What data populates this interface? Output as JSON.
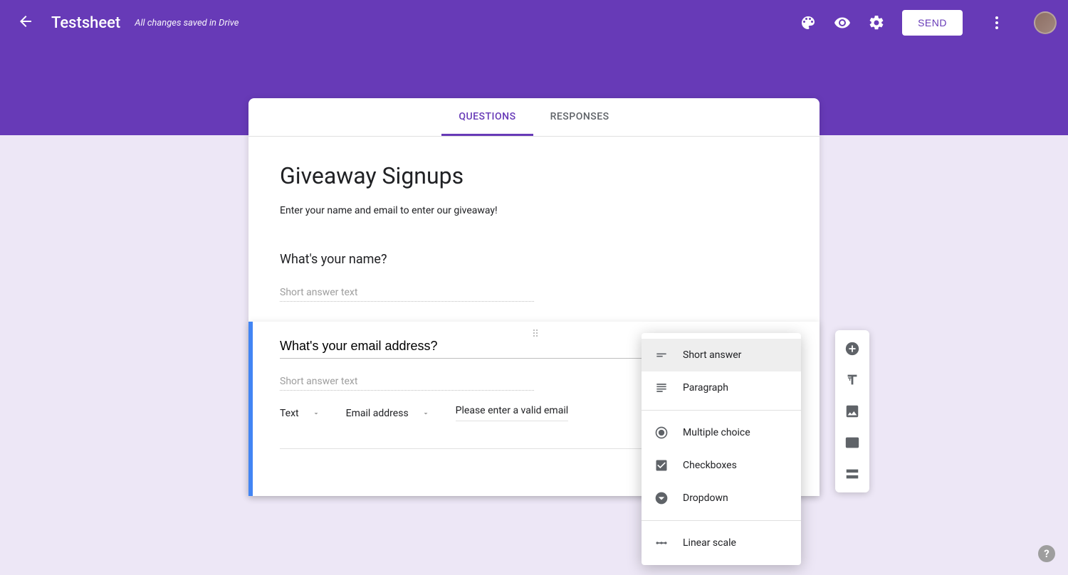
{
  "header": {
    "doc_title": "Testsheet",
    "save_status": "All changes saved in Drive",
    "send_label": "SEND"
  },
  "tabs": {
    "questions": "QUESTIONS",
    "responses": "RESPONSES"
  },
  "form": {
    "title": "Giveaway Signups",
    "description": "Enter your name and email to enter our giveaway!"
  },
  "questions": [
    {
      "title": "What's your name?",
      "answer_placeholder": "Short answer text"
    },
    {
      "title": "What's your email address?",
      "answer_placeholder": "Short answer text",
      "validation": {
        "type": "Text",
        "subtype": "Email address",
        "error_text": "Please enter a valid email"
      }
    }
  ],
  "type_menu": {
    "short_answer": "Short answer",
    "paragraph": "Paragraph",
    "multiple_choice": "Multiple choice",
    "checkboxes": "Checkboxes",
    "dropdown": "Dropdown",
    "linear_scale": "Linear scale"
  },
  "help_label": "?"
}
